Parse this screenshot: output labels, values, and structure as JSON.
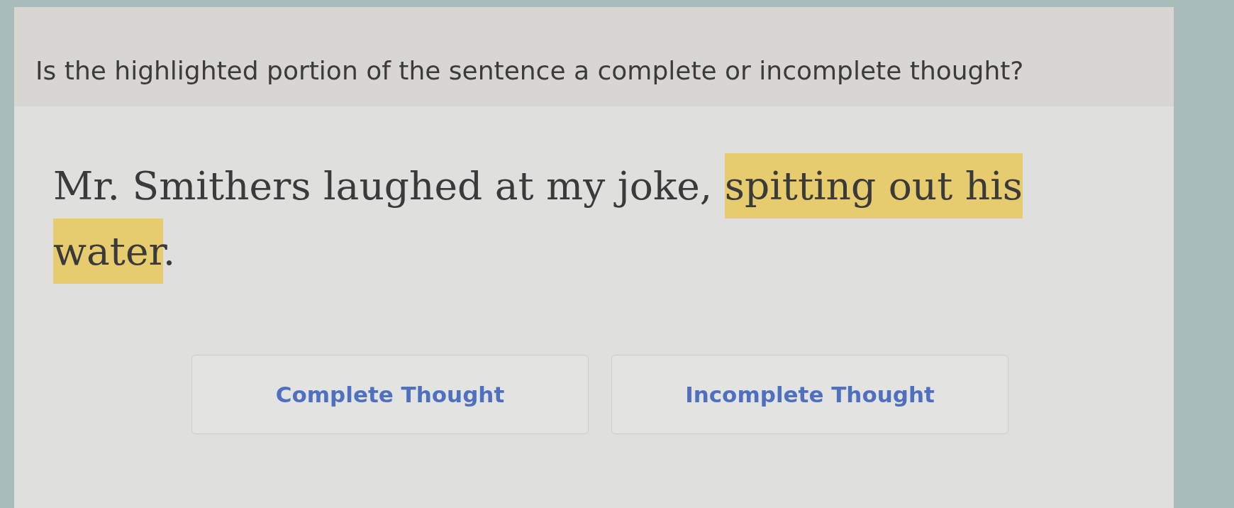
{
  "question": {
    "text": "Is the highlighted portion of the sentence a complete or incomplete thought?"
  },
  "sentence": {
    "segments": [
      {
        "text": "Mr. Smithers laughed at my joke, ",
        "highlighted": false
      },
      {
        "text": "spitting ",
        "highlighted": true
      },
      {
        "text": "out ",
        "highlighted": true
      },
      {
        "text": "his ",
        "highlighted": true
      },
      {
        "text": "water",
        "highlighted": true
      },
      {
        "text": ".",
        "highlighted": false
      }
    ]
  },
  "answers": [
    {
      "label": "Complete Thought",
      "selected": false
    },
    {
      "label": "Incomplete Thought",
      "selected": false
    }
  ]
}
